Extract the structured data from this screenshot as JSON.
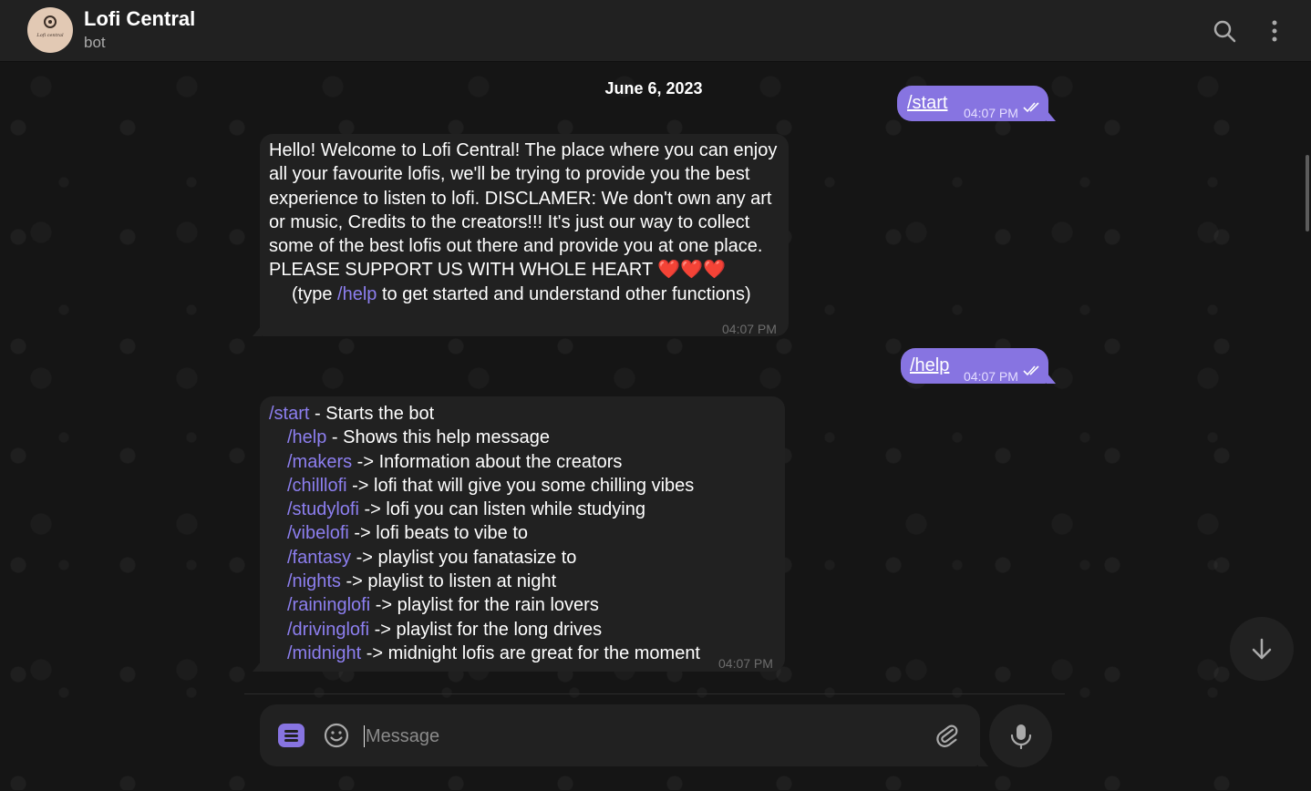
{
  "header": {
    "title": "Lofi Central",
    "subtitle": "bot",
    "avatar_text": "Lofi central",
    "icons": [
      "search-icon",
      "more-vertical-icon"
    ]
  },
  "chat": {
    "date": "June 6, 2023",
    "messages": [
      {
        "direction": "out",
        "command": "/start",
        "time": "04:07 PM",
        "status": "read"
      },
      {
        "direction": "in",
        "lines": [
          "Hello! Welcome to Lofi Central! The place where you can enjoy",
          "all your favourite lofis, we'll be trying to provide you the best",
          "experience to listen to lofi. DISCLAMER: We don't own any art",
          "or music, Credits to the creators!!! It's just our way to collect",
          "some of the best lofis out there and provide you at one place.",
          "PLEASE SUPPORT US WITH WHOLE HEART ❤️❤️❤️"
        ],
        "hint_prefix": "(type ",
        "hint_command": "/help",
        "hint_suffix": " to get started and understand other functions)",
        "time": "04:07 PM"
      },
      {
        "direction": "out",
        "command": "/help",
        "time": "04:07 PM",
        "status": "read"
      },
      {
        "direction": "in",
        "items": [
          {
            "cmd": "/start",
            "desc": " - Starts the bot"
          },
          {
            "cmd": "/help",
            "desc": " - Shows this help message"
          },
          {
            "cmd": "/makers",
            "desc": " -> Information about the creators"
          },
          {
            "cmd": "/chilllofi",
            "desc": " -> lofi that will give you some chilling vibes"
          },
          {
            "cmd": "/studylofi",
            "desc": " -> lofi you can listen while studying"
          },
          {
            "cmd": "/vibelofi",
            "desc": " -> lofi beats to vibe to"
          },
          {
            "cmd": "/fantasy",
            "desc": " -> playlist you fanatasize to"
          },
          {
            "cmd": "/nights",
            "desc": " -> playlist to listen at night"
          },
          {
            "cmd": "/raininglofi",
            "desc": " -> playlist for the rain lovers"
          },
          {
            "cmd": "/drivinglofi",
            "desc": " -> playlist for the long drives"
          },
          {
            "cmd": "/midnight",
            "desc": " -> midnight lofis are great for the moment"
          }
        ],
        "time": "04:07 PM"
      }
    ]
  },
  "composer": {
    "placeholder": "Message",
    "icons": [
      "menu-icon",
      "emoji-icon",
      "paperclip-icon",
      "microphone-icon"
    ]
  },
  "scroll_down_icon": "arrow-down-icon",
  "colors": {
    "accent": "#8774e1",
    "command_link": "#8d7ff0",
    "bubble_incoming": "#212121",
    "background": "#151515"
  }
}
